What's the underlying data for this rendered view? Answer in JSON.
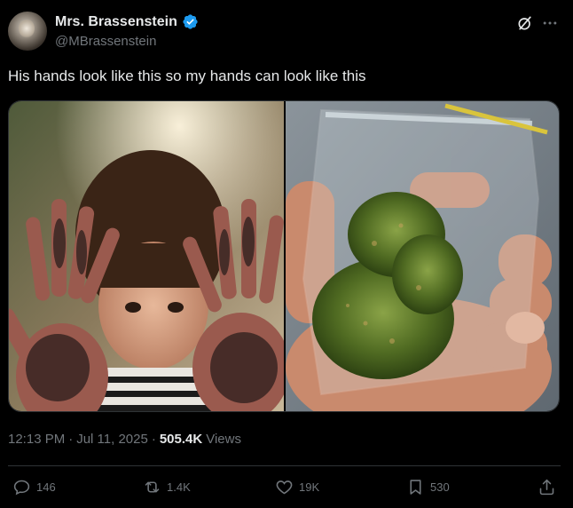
{
  "author": {
    "display_name": "Mrs. Brassenstein",
    "handle": "@MBrassenstein",
    "verified_color": "#1d9bf0"
  },
  "header_icons": [
    "grok-icon",
    "more-icon"
  ],
  "tweet": {
    "text": "His hands look like this so my hands can look like this"
  },
  "media": [
    {
      "name": "photo-child-muddy-hands"
    },
    {
      "name": "photo-hand-holding-bag"
    }
  ],
  "meta": {
    "time": "12:13 PM",
    "sep1": "·",
    "date": "Jul 11, 2025",
    "sep2": "·",
    "views_count": "505.4K",
    "views_label": "Views"
  },
  "actions": {
    "replies": "146",
    "reposts": "1.4K",
    "likes": "19K",
    "bookmarks": "530"
  },
  "colors": {
    "background": "#000000",
    "text": "#e7e9ea",
    "muted": "#71767b",
    "border": "#2f3336",
    "accent": "#1d9bf0"
  }
}
